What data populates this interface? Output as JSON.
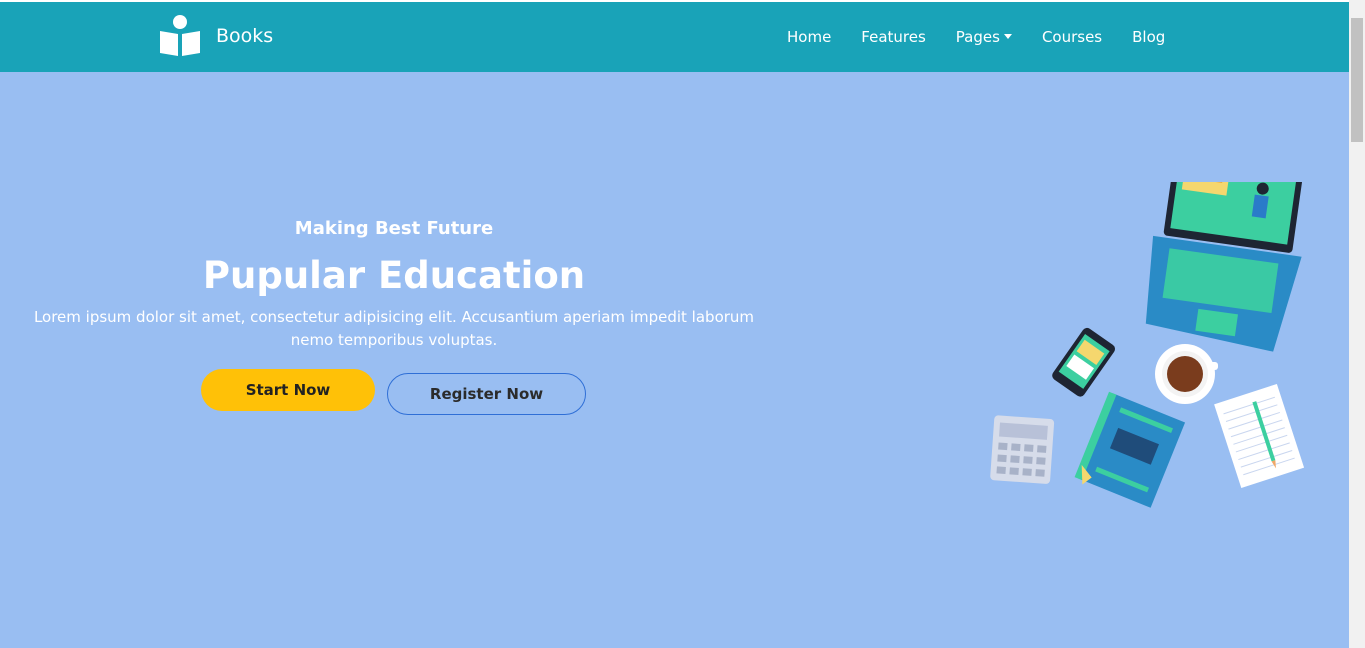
{
  "brand": {
    "name": "Books",
    "icon": "book-reader-icon"
  },
  "nav": {
    "items": [
      {
        "label": "Home"
      },
      {
        "label": "Features"
      },
      {
        "label": "Pages"
      },
      {
        "label": "Courses"
      },
      {
        "label": "Blog"
      }
    ]
  },
  "hero": {
    "subtitle": "Making Best Future",
    "title": "Pupular Education",
    "description": "Lorem ipsum dolor sit amet, consectetur adipisicing elit. Accusantium aperiam impedit laborum nemo temporibus voluptas.",
    "start_label": "Start Now",
    "register_label": "Register Now",
    "illustration": "desk-illustration"
  },
  "colors": {
    "navbar": "#19a3b8",
    "hero_bg": "#99bef2",
    "start_button": "#ffc107",
    "register_border": "#2f6fd6"
  }
}
